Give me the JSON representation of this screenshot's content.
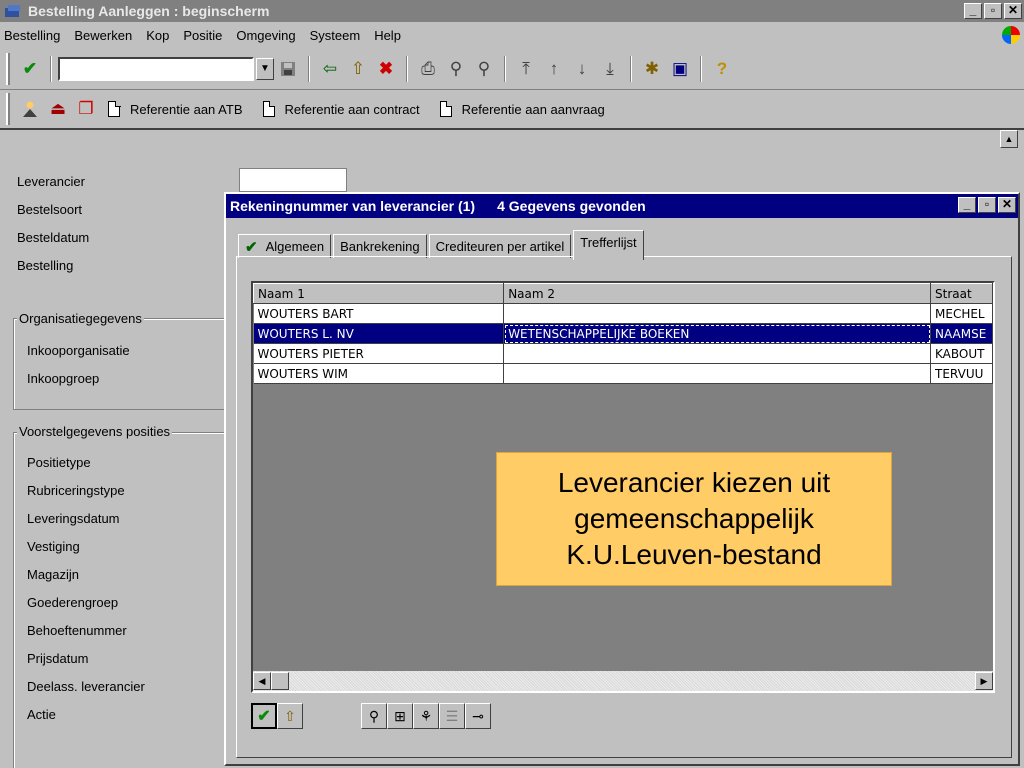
{
  "window": {
    "title": "Bestelling Aanleggen : beginscherm",
    "controls": [
      "_",
      "▫",
      "✕"
    ]
  },
  "menu": [
    "Bestelling",
    "Bewerken",
    "Kop",
    "Positie",
    "Omgeving",
    "Systeem",
    "Help"
  ],
  "toolbar2": {
    "ref_atb": "Referentie aan ATB",
    "ref_contract": "Referentie aan contract",
    "ref_aanvraag": "Referentie aan aanvraag"
  },
  "form": {
    "labels_top": [
      "Leverancier",
      "Bestelsoort",
      "Besteldatum",
      "Bestelling"
    ],
    "group1_title": "Organisatiegegevens",
    "group1_labels": [
      "Inkooporganisatie",
      "Inkoopgroep"
    ],
    "group2_title": "Voorstelgegevens posities",
    "group2_labels": [
      "Positietype",
      "Rubriceringstype",
      "Leveringsdatum",
      "Vestiging",
      "Magazijn",
      "Goederengroep",
      "Behoeftenummer",
      "Prijsdatum",
      "Deelass. leverancier",
      "Actie"
    ]
  },
  "dialog": {
    "title": "Rekeningnummer van leverancier (1)",
    "count": "4 Gegevens gevonden",
    "tabs": [
      "Algemeen",
      "Bankrekening",
      "Crediteuren per artikel",
      "Trefferlijst"
    ],
    "active_tab": "Trefferlijst",
    "columns": [
      "Naam 1",
      "Naam 2",
      "Straat"
    ],
    "rows": [
      {
        "naam1": "WOUTERS BART",
        "naam2": "",
        "straat": "MECHEL"
      },
      {
        "naam1": "WOUTERS L. NV",
        "naam2": "WETENSCHAPPELIJKE BOEKEN",
        "straat": "NAAMSE"
      },
      {
        "naam1": "WOUTERS PIETER",
        "naam2": "",
        "straat": "KABOUT"
      },
      {
        "naam1": "WOUTERS WIM",
        "naam2": "",
        "straat": "TERVUU"
      }
    ],
    "selected_row": 1
  },
  "callout": {
    "line1": "Leverancier kiezen uit",
    "line2": "gemeenschappelijk",
    "line3": "K.U.Leuven-bestand"
  }
}
